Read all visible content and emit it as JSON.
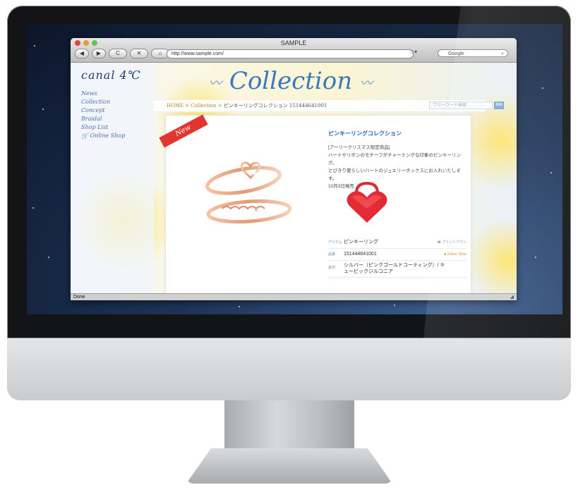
{
  "browser": {
    "window_title": "SAMPLE",
    "url": "http://www.sample.com/",
    "search_placeholder": "Google",
    "status": "Done",
    "buttons": {
      "back": "◀",
      "forward": "▶",
      "reload": "C",
      "stop": "✕",
      "home": "⌂"
    }
  },
  "site": {
    "logo": "canal 4℃",
    "nav": [
      "News",
      "Collection",
      "Concept",
      "Braidal",
      "Shop List",
      "🛒 Online Shop"
    ],
    "hero_title": "Collection",
    "breadcrumb": {
      "home": "HOME",
      "sep1": ">",
      "section": "Collection",
      "sep2": ">",
      "current": "ピンキーリングコレクション 151444641001"
    },
    "search_placeholder": "フリーワード検索",
    "search_button": "検索"
  },
  "product": {
    "badge": "New",
    "title": "ピンキーリングコレクション",
    "description": [
      "[アーリークリスマス限定商品]",
      "ハートやリボンのモチーフがチャーミングな印象のピンキーリング。",
      "とびきり愛らしいハートのジュエリーボックスにお入れいたします。",
      "10月3日発売"
    ],
    "specs": [
      {
        "label": "アイテム",
        "value": "ピンキーリング",
        "action": "🖶 プリントアウト"
      },
      {
        "label": "品番",
        "value": "151444641001",
        "action": "■ Online Shop"
      },
      {
        "label": "素材",
        "value": "シルバー（ピンクゴールドコーティング）/ キュービックジルコニア",
        "action": ""
      }
    ]
  },
  "colors": {
    "hero": "#3a77c1",
    "badge": "#e0362f",
    "breadcrumb": "#b08a33",
    "online_shop": "#d18a1c"
  }
}
